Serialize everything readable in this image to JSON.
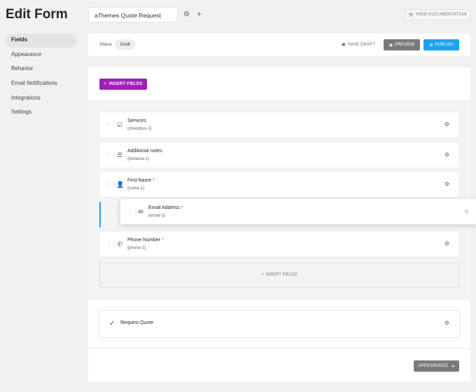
{
  "header": {
    "title": "Edit Form",
    "form_name": "aThemes Quote Request",
    "view_documentation": "VIEW DOCUMENTATION"
  },
  "sidebar": {
    "items": [
      {
        "label": "Fields",
        "active": true
      },
      {
        "label": "Appearance",
        "active": false
      },
      {
        "label": "Behavior",
        "active": false
      },
      {
        "label": "Email Notifications",
        "active": false
      },
      {
        "label": "Integrations",
        "active": false
      },
      {
        "label": "Settings",
        "active": false
      }
    ]
  },
  "status_bar": {
    "status_label": "Status",
    "status_value": "Draft",
    "save_draft": "SAVE DRAFT",
    "preview": "PREVIEW",
    "publish": "PUBLISH"
  },
  "canvas": {
    "insert_fields_label": "INSERT FIELDS",
    "fields": [
      {
        "label": "Services",
        "id": "{checkbox-1}",
        "required": false,
        "icon": "checkbox-icon"
      },
      {
        "label": "Additional notes",
        "id": "{textarea-1}",
        "required": false,
        "icon": "textarea-icon"
      },
      {
        "label": "First Name",
        "id": "{name-1}",
        "required": true,
        "icon": "person-icon"
      },
      {
        "label": "Email Address",
        "id": "{email-1}",
        "required": true,
        "icon": "envelope-icon",
        "dragging": true
      },
      {
        "label": "Phone Number",
        "id": "{phone-1}",
        "required": true,
        "icon": "phone-icon"
      }
    ],
    "insert_fields_bottom": "INSERT FIELDS",
    "submit_label": "Request Quote",
    "required_marker": "*"
  },
  "footer": {
    "appearance_button": "APPEARANCE"
  },
  "colors": {
    "accent_purple": "#a020b8",
    "publish_blue": "#1da1f2",
    "grey_button": "#7a7a7a",
    "required_red": "#e33"
  }
}
